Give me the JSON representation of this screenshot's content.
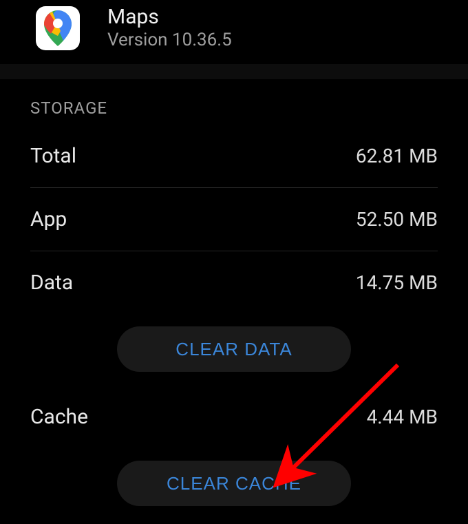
{
  "header": {
    "app_name": "Maps",
    "version_line": "Version 10.36.5"
  },
  "section": {
    "title": "STORAGE"
  },
  "rows": {
    "total": {
      "label": "Total",
      "value": "62.81 MB"
    },
    "app": {
      "label": "App",
      "value": "52.50 MB"
    },
    "data": {
      "label": "Data",
      "value": "14.75 MB"
    },
    "cache": {
      "label": "Cache",
      "value": "4.44 MB"
    }
  },
  "buttons": {
    "clear_data": "CLEAR DATA",
    "clear_cache": "CLEAR CACHE"
  },
  "annotation": {
    "arrow_color": "#ff0000"
  }
}
